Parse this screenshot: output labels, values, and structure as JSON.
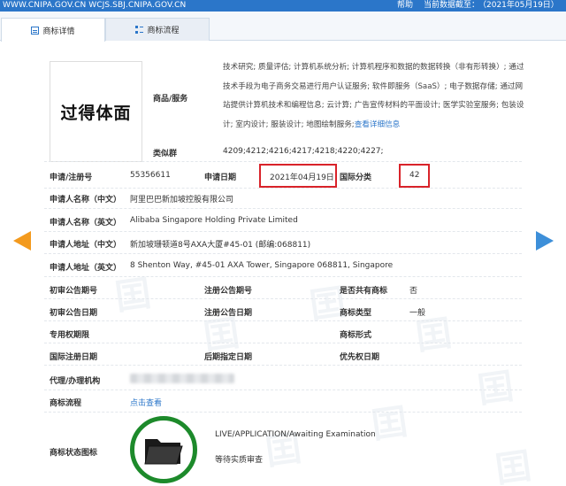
{
  "topbar": {
    "site": "WWW.CNIPA.GOV.CN WCJS.SBJ.CNIPA.GOV.CN",
    "help": "帮助",
    "cutoff_label": "当前数据截至：",
    "cutoff_value": "（2021年05月19日）"
  },
  "tabs": [
    {
      "label": "商标详情",
      "icon": "detail-icon"
    },
    {
      "label": "商标流程",
      "icon": "list-icon"
    }
  ],
  "mark": {
    "text": "过得体面"
  },
  "goods": {
    "label": "商品/服务",
    "text": "技术研究; 质量评估; 计算机系统分析; 计算机程序和数据的数据转换（非有形转换）; 通过技术手段为电子商务交易进行用户认证服务; 软件即服务（SaaS）; 电子数据存储; 通过网站提供计算机技术和编程信息; 云计算; 广告宣传材料的平面设计; 医学实验室服务; 包装设计; 室内设计; 服装设计; 地图绘制服务;",
    "more_link": "查看详细信息"
  },
  "similar": {
    "label": "类似群",
    "value": "4209;4212;4216;4217;4218;4220;4227;"
  },
  "reg_no": {
    "label": "申请/注册号",
    "value": "55356611"
  },
  "app_date": {
    "label": "申请日期",
    "value": "2021年04月19日"
  },
  "intl_class": {
    "label": "国际分类",
    "value": "42"
  },
  "applicant_cn": {
    "label": "申请人名称（中文）",
    "value": "阿里巴巴新加坡控股有限公司"
  },
  "applicant_en": {
    "label": "申请人名称（英文）",
    "value": "Alibaba Singapore Holding Private Limited"
  },
  "address_cn": {
    "label": "申请人地址（中文）",
    "value": "新加坡珊顿道8号AXA大厦#45-01 (邮编:068811)"
  },
  "address_en": {
    "label": "申请人地址（英文）",
    "value": "8 Shenton Way, #45-01 AXA Tower, Singapore 068811, Singapore"
  },
  "grid": {
    "prelim_no": "初审公告期号",
    "reg_notice_no": "注册公告期号",
    "shared": "是否共有商标",
    "shared_value": "否",
    "prelim_date": "初审公告日期",
    "reg_notice_date": "注册公告日期",
    "mark_type": "商标类型",
    "mark_type_value": "一般",
    "exclusive_period": "专用权期限",
    "mark_form": "商标形式",
    "intl_reg_date": "国际注册日期",
    "later_date": "后期指定日期",
    "priority_date": "优先权日期"
  },
  "agent": {
    "label": "代理/办理机构"
  },
  "flow": {
    "label": "商标流程",
    "link": "点击查看"
  },
  "status": {
    "label": "商标状态图标",
    "en": "LIVE/APPLICATION/Awaiting Examination",
    "cn": "等待实质审查",
    "icon": "folder-icon"
  },
  "colors": {
    "topbar": "#2b76c9",
    "highlight": "#d9232a",
    "status_ring": "#1d8a2b",
    "left_arrow": "#f39a1e",
    "right_arrow": "#3d8fd9"
  }
}
